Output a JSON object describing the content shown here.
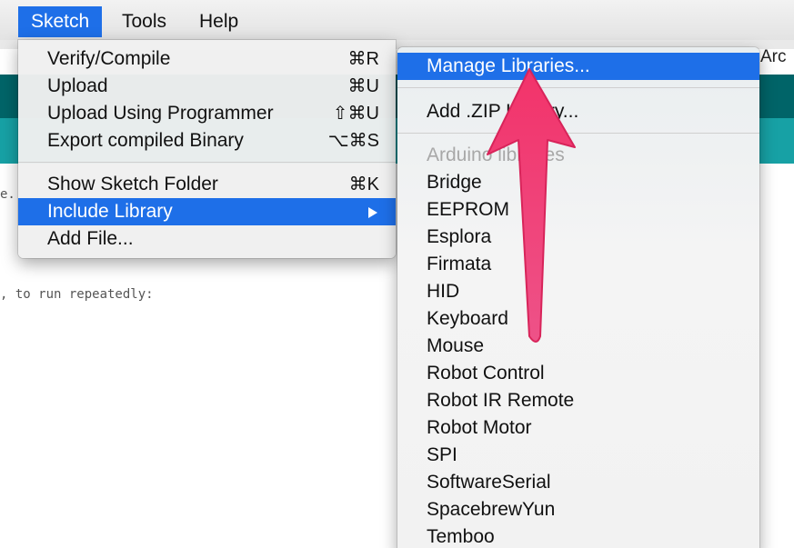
{
  "menubar": {
    "items": [
      "Sketch",
      "Tools",
      "Help"
    ],
    "active": "Sketch"
  },
  "ide": {
    "right_label": "Arc",
    "code_fragment_1": "e.",
    "code_fragment_2": ", to run repeatedly:"
  },
  "sketch_menu": {
    "items": [
      {
        "label": "Verify/Compile",
        "shortcut": "⌘R"
      },
      {
        "label": "Upload",
        "shortcut": "⌘U"
      },
      {
        "label": "Upload Using Programmer",
        "shortcut": "⇧⌘U"
      },
      {
        "label": "Export compiled Binary",
        "shortcut": "⌥⌘S"
      },
      {
        "label": "Show Sketch Folder",
        "shortcut": "⌘K"
      },
      {
        "label": "Include Library",
        "shortcut": ""
      },
      {
        "label": "Add File...",
        "shortcut": ""
      }
    ],
    "selected": "Include Library"
  },
  "library_menu": {
    "manage": "Manage Libraries...",
    "add_zip": "Add .ZIP Library...",
    "section_header": "Arduino libraries",
    "libraries": [
      "Bridge",
      "EEPROM",
      "Esplora",
      "Firmata",
      "HID",
      "Keyboard",
      "Mouse",
      "Robot Control",
      "Robot IR Remote",
      "Robot Motor",
      "SPI",
      "SoftwareSerial",
      "SpacebrewYun",
      "Temboo"
    ]
  },
  "colors": {
    "selection": "#1e6fe8",
    "toolbar": "#006468",
    "tabs": "#17a1a5",
    "annotation_arrow": "#f0366a"
  },
  "icons": {
    "submenu_indicator": "triangle-right-icon",
    "annotation": "up-arrow-annotation"
  }
}
